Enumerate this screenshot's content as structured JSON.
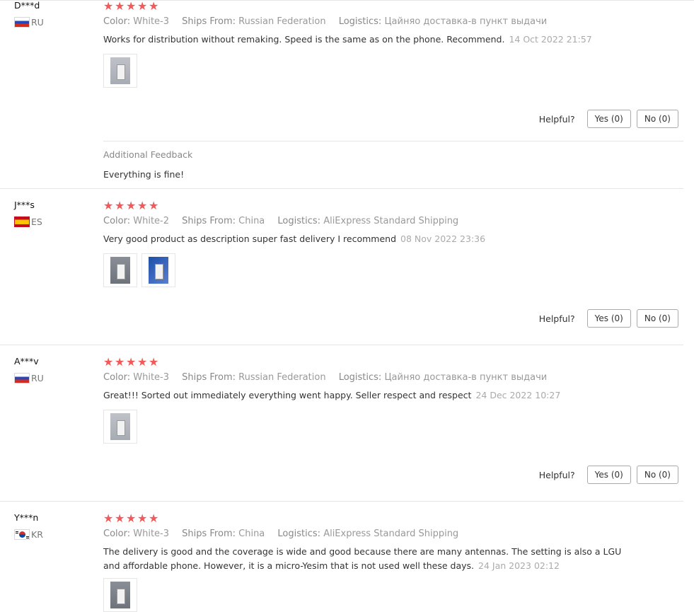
{
  "labels": {
    "color": "Color:",
    "ships_from": "Ships From:",
    "logistics": "Logistics:",
    "helpful": "Helpful?",
    "yes": "Yes (0)",
    "no": "No (0)",
    "additional_feedback": "Additional Feedback"
  },
  "reviews": [
    {
      "user": "D***d",
      "country": "RU",
      "stars": 5,
      "color": "White-3",
      "ships_from": "Russian Federation",
      "logistics": "Цайняо доставка-в пункт выдачи",
      "text": "Works for distribution without remaking. Speed is the same as on the phone. Recommend.",
      "date": "14 Oct 2022 21:57",
      "images": 1,
      "additional_feedback": "Everything is fine!"
    },
    {
      "user": "J***s",
      "country": "ES",
      "stars": 5,
      "color": "White-2",
      "ships_from": "China",
      "logistics": "AliExpress Standard Shipping",
      "text": "Very good product as description super fast delivery I recommend",
      "date": "08 Nov 2022 23:36",
      "images": 2
    },
    {
      "user": "A***v",
      "country": "RU",
      "stars": 5,
      "color": "White-3",
      "ships_from": "Russian Federation",
      "logistics": "Цайняо доставка-в пункт выдачи",
      "text": "Great!!! Sorted out immediately everything went happy. Seller respect and respect",
      "date": "24 Dec 2022 10:27",
      "images": 1
    },
    {
      "user": "Y***n",
      "country": "KR",
      "stars": 5,
      "color": "White-3",
      "ships_from": "China",
      "logistics": "AliExpress Standard Shipping",
      "text_line1": "The delivery is good and the coverage is wide and good because there are many antennas. The setting is also a LGU",
      "text_line2": "and affordable phone. However, it is a micro-Yesim that is not used well these days.",
      "date": "24 Jan 2023 02:12",
      "images": 1
    }
  ]
}
